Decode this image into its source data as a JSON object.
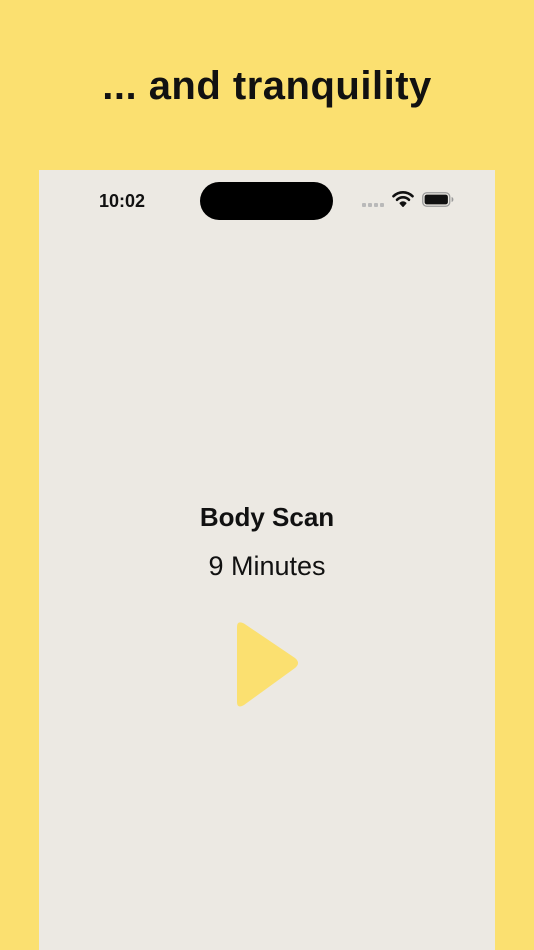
{
  "page": {
    "headline": "... and tranquility",
    "background_color": "#FBE070"
  },
  "phone": {
    "screen_color": "#ECE9E3",
    "status_bar": {
      "time": "10:02",
      "signal_icon": "signal-bars-icon",
      "wifi_icon": "wifi-icon",
      "battery_icon": "battery-icon"
    },
    "content": {
      "title": "Body Scan",
      "subtitle": "9 Minutes",
      "play_icon": "play-icon",
      "accent_color": "#FBE070"
    }
  }
}
